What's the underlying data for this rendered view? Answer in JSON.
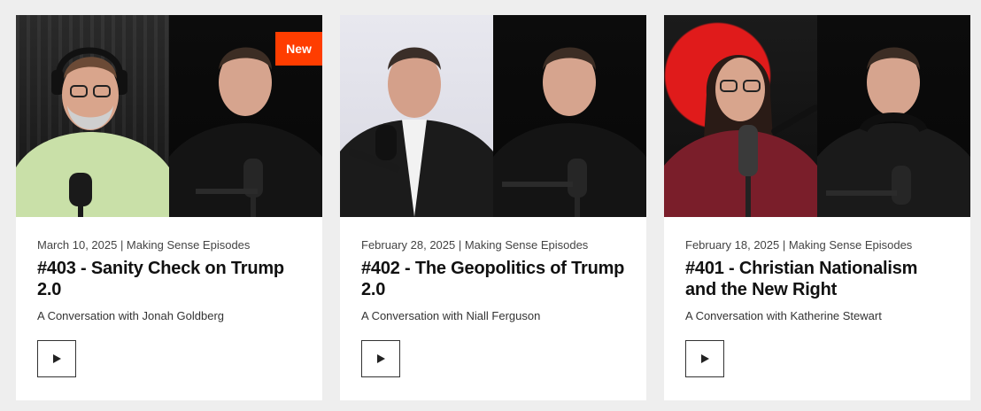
{
  "episodes": [
    {
      "date": "March 10, 2025",
      "category": "Making Sense Episodes",
      "meta": "March 10, 2025 | Making Sense Episodes",
      "title": "#403 - Sanity Check on Trump 2.0",
      "subtitle": "A Conversation with Jonah Goldberg",
      "badge": "New",
      "guest_bg": "#2a2a2a",
      "guest_shirt": "#c9e0a8",
      "host_bg": "#0c0c0c"
    },
    {
      "date": "February 28, 2025",
      "category": "Making Sense Episodes",
      "meta": "February 28, 2025 | Making Sense Episodes",
      "title": "#402 - The Geopolitics of Trump 2.0",
      "subtitle": "A Conversation with Niall Ferguson",
      "badge": "",
      "guest_bg": "#e0e0e8",
      "guest_shirt": "#1b1b1b",
      "host_bg": "#0c0c0c"
    },
    {
      "date": "February 18, 2025",
      "category": "Making Sense Episodes",
      "meta": "February 18, 2025 | Making Sense Episodes",
      "title": "#401 - Christian Nationalism and the New Right",
      "subtitle": "A Conversation with Katherine Stewart",
      "badge": "",
      "guest_bg": "#1b1b1b",
      "guest_shirt": "#7a1e2a",
      "host_bg": "#0c0c0c"
    }
  ],
  "icons": {
    "play": "play-icon"
  },
  "colors": {
    "badge": "#ff3d00",
    "page_bg": "#eeeeee",
    "card_bg": "#ffffff"
  }
}
